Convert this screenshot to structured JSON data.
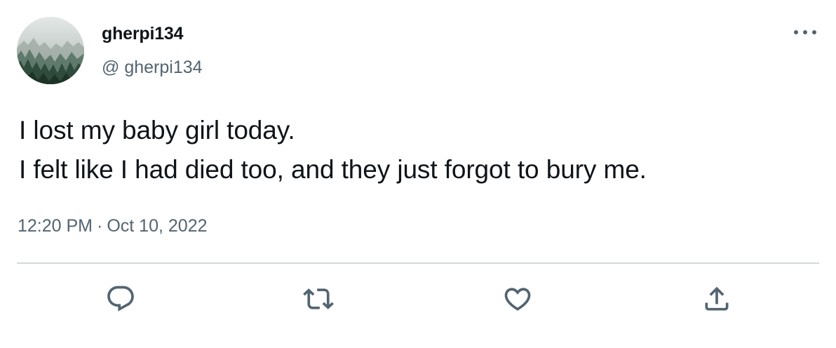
{
  "author": {
    "display_name": "gherpi134",
    "handle": "@ gherpi134",
    "avatar": "misty-forest-avatar"
  },
  "tweet": {
    "lines": [
      "I lost my baby girl today.",
      "I felt like I had died too, and they just forgot to bury me."
    ],
    "time": "12:20 PM",
    "separator": "·",
    "date": "Oct 10, 2022"
  },
  "actions": {
    "more_icon": "more-horizontal-icon",
    "reply_icon": "reply-icon",
    "retweet_icon": "retweet-icon",
    "like_icon": "heart-icon",
    "share_icon": "share-icon"
  },
  "colors": {
    "text_primary": "#0f1419",
    "text_secondary": "#536471",
    "divider": "#cfd9de"
  }
}
